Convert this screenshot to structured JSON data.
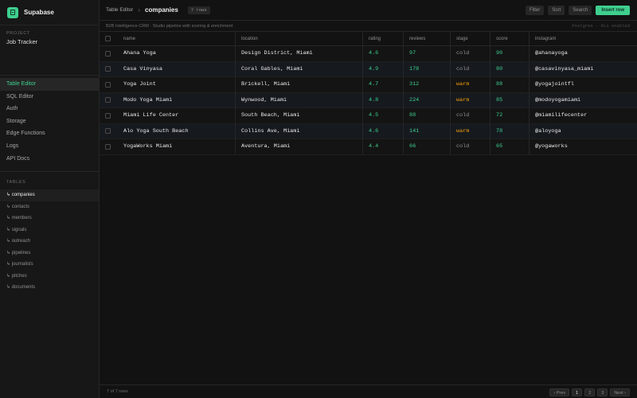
{
  "app": {
    "name": "Supabase"
  },
  "project": {
    "label": "PROJECT",
    "name": "Job Tracker"
  },
  "nav": [
    {
      "label": "Table Editor",
      "active": true
    },
    {
      "label": "SQL Editor"
    },
    {
      "label": "Auth"
    },
    {
      "label": "Storage"
    },
    {
      "label": "Edge Functions"
    },
    {
      "label": "Logs"
    },
    {
      "label": "API Docs"
    }
  ],
  "tables_section": {
    "label": "TABLES",
    "items": [
      "↳ companies",
      "↳ contacts",
      "↳ members",
      "↳ signals",
      "↳ outreach",
      "↳ pipelines",
      "↳ journalists",
      "↳ pitches",
      "↳ documents"
    ]
  },
  "topbar": {
    "breadcrumb": "Table Editor",
    "current": "companies",
    "rows_badge": "7 rows",
    "actions": [
      "Filter",
      "Sort",
      "Search"
    ],
    "insert_label": "Insert row"
  },
  "subbar": {
    "description": "B2B Intelligence CRM · Studio pipeline with scoring & enrichment",
    "right": "Postgres · RLS enabled"
  },
  "table": {
    "columns": [
      "name",
      "location",
      "rating",
      "reviews",
      "stage",
      "score",
      "instagram"
    ],
    "rows": [
      [
        "Ahana Yoga",
        "Design District, Miami",
        "4.6",
        "97",
        "cold",
        "90",
        "@ahanayoga"
      ],
      [
        "Casa Vinyasa",
        "Coral Gables, Miami",
        "4.9",
        "178",
        "cold",
        "80",
        "@casavinyasa_miami"
      ],
      [
        "Yoga Joint",
        "Brickell, Miami",
        "4.7",
        "312",
        "warm",
        "88",
        "@yogajointfl"
      ],
      [
        "Modo Yoga Miami",
        "Wynwood, Miami",
        "4.8",
        "224",
        "warm",
        "85",
        "@modoyogamiami"
      ],
      [
        "Miami Life Center",
        "South Beach, Miami",
        "4.5",
        "88",
        "cold",
        "72",
        "@miamilifecenter"
      ],
      [
        "Alo Yoga South Beach",
        "Collins Ave, Miami",
        "4.6",
        "141",
        "warm",
        "78",
        "@aloyoga"
      ],
      [
        "YogaWorks Miami",
        "Aventura, Miami",
        "4.4",
        "66",
        "cold",
        "65",
        "@yogaworks"
      ]
    ]
  },
  "footer": {
    "count": "7 of 7 rows",
    "pager": {
      "prev": "‹ Prev",
      "pages": [
        "1",
        "2",
        "3"
      ],
      "next": "Next ›"
    }
  },
  "colors": {
    "accent": "#3ecf8e",
    "warm": "#f59e0b",
    "background": "#121212"
  }
}
